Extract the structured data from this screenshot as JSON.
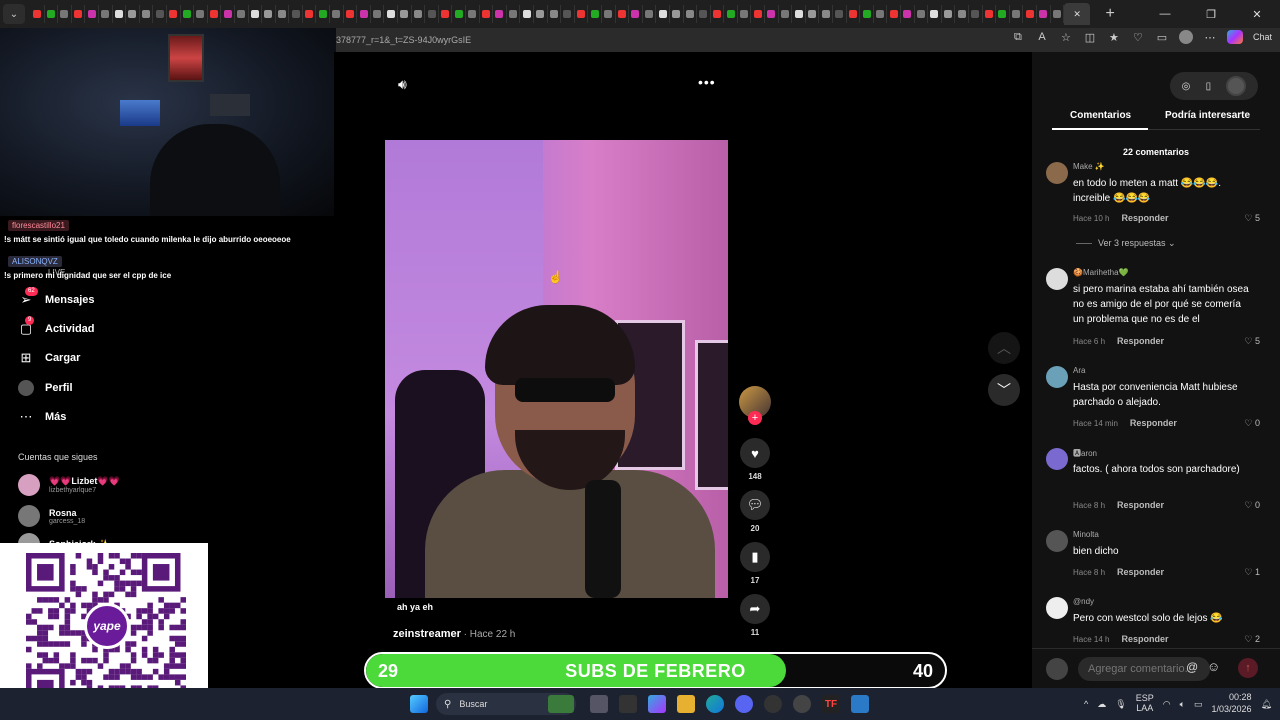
{
  "browser": {
    "url": "378777_r=1&_t=ZS-94J0wyrGsIE",
    "chat_label": "Chat"
  },
  "stream_chat": {
    "user1": "florescastillo21",
    "line1": "!s mátt se sintió igual que toledo cuando milenka le dijo aburrido oeoeoeoe",
    "user2": "ALISONQVZ",
    "live_label": "LIVE",
    "line2": "!s primero mi dignidad que ser el cpp de ice"
  },
  "sidebar": {
    "items": [
      {
        "label": "Mensajes",
        "badge": "62",
        "icon": "paper-plane-icon"
      },
      {
        "label": "Actividad",
        "badge": "9",
        "icon": "inbox-icon"
      },
      {
        "label": "Cargar",
        "icon": "upload-icon"
      },
      {
        "label": "Perfil",
        "icon": "profile-icon"
      },
      {
        "label": "Más",
        "icon": "more-icon"
      }
    ],
    "following_title": "Cuentas que sigues",
    "following": [
      {
        "name": "💗💗Lizbet💗💗",
        "handle": "lizbethyarlque7"
      },
      {
        "name": "Rosna",
        "handle": "garcess_18"
      },
      {
        "name": "Sophiejork ✨",
        "handle": ""
      }
    ]
  },
  "qr": {
    "brand": "yape"
  },
  "video": {
    "caption": "ah ya eh",
    "author": "zeinstreamer",
    "time": " · Hace 22 h",
    "likes": "148",
    "comments": "20",
    "saves": "17",
    "shares": "11"
  },
  "subs_goal": {
    "current": "29",
    "title": "SUBS DE FEBRERO",
    "goal": "40",
    "progress": 0.725,
    "fill_color": "#4cd93a"
  },
  "comments_panel": {
    "tab_comments": "Comentarios",
    "tab_interest": "Podría interesarte",
    "count": "22 comentarios",
    "view_replies": "Ver 3 respuestas ⌄",
    "placeholder": "Agregar comentario...",
    "reply_label": "Responder",
    "items": [
      {
        "user": "Make ✨",
        "text": "en todo lo meten a matt 😂😂😂. increible 😂😂😂",
        "time": "Hace 10 h",
        "likes": "5"
      },
      {
        "user": "🍪Marihetha💚",
        "text": "si pero marina estaba ahí también osea no es amigo de el por qué se comería un problema que no es de el",
        "time": "Hace 6 h",
        "likes": "5"
      },
      {
        "user": "Ara",
        "text": "Hasta por conveniencia Matt hubiese parchado o alejado.",
        "time": "Hace 14 min",
        "likes": "0"
      },
      {
        "user": "🅰aron",
        "text": "factos. ( ahora todos son parchadore)",
        "time": "Hace 8 h",
        "likes": "0"
      },
      {
        "user": "Minolta",
        "text": "bien dicho",
        "time": "Hace 8 h",
        "likes": "1"
      },
      {
        "user": "@ndy",
        "text": "Pero con westcol solo de lejos 😂",
        "time": "Hace 14 h",
        "likes": "2"
      }
    ]
  },
  "taskbar": {
    "search_placeholder": "Buscar",
    "lang_line1": "ESP",
    "lang_line2": "LAA",
    "time": "00:28",
    "date": "1/03/2026"
  }
}
